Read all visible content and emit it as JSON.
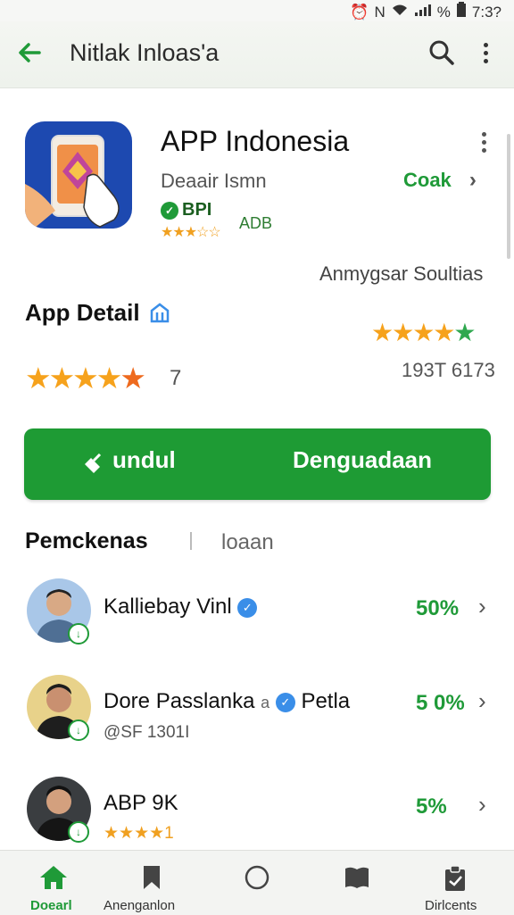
{
  "status": {
    "time": "7:3?",
    "icons": [
      "alarm-icon",
      "nfc-icon",
      "wifi-icon",
      "signal-icon",
      "battery-icon"
    ],
    "signal_text": "%"
  },
  "app_bar": {
    "title": "Nitlak Inloas'a",
    "back_icon": "arrow-left-icon",
    "search_icon": "search-icon",
    "more_icon": "more-vertical-icon"
  },
  "app": {
    "name": "APP Indonesia",
    "developer": "Deaair Ismn",
    "open_label": "Coak",
    "badge": "BPI",
    "adb": "ADB",
    "company": "Anmygsar Soultias"
  },
  "detail": {
    "title": "App Detail",
    "right_stars": "★★★★★",
    "big_stars": "★★★★★",
    "big_stars_suffix": "7",
    "rating_count": "193T 6173"
  },
  "actions": {
    "install_label": "undul",
    "update_label": "Denguadaan"
  },
  "tabs": {
    "active": "Pemckenas",
    "inactive": "loaan"
  },
  "rows": [
    {
      "name": "Kalliebay Vinl",
      "sub": "",
      "value": "50%",
      "verified": true
    },
    {
      "name": "Dore Passlanka",
      "extra": "a",
      "tag": "Petla",
      "sub": "@SF 1301I",
      "value": "5 0%",
      "verified": true
    },
    {
      "name": "ABP 9K",
      "sub": "★★★★1",
      "value": "5%",
      "verified": false
    }
  ],
  "bottom_nav": [
    {
      "label": "Doearl",
      "icon": "home-icon",
      "active": true
    },
    {
      "label": "Anenganlon",
      "icon": "bookmark-icon",
      "active": false
    },
    {
      "label": "",
      "icon": "circle-icon",
      "active": false
    },
    {
      "label": "",
      "icon": "book-icon",
      "active": false
    },
    {
      "label": "Dirlcents",
      "icon": "clipboard-icon",
      "active": false
    }
  ],
  "colors": {
    "accent": "#1e9b34",
    "star": "#f6a21c",
    "icon_bg": "#1d49b0"
  }
}
